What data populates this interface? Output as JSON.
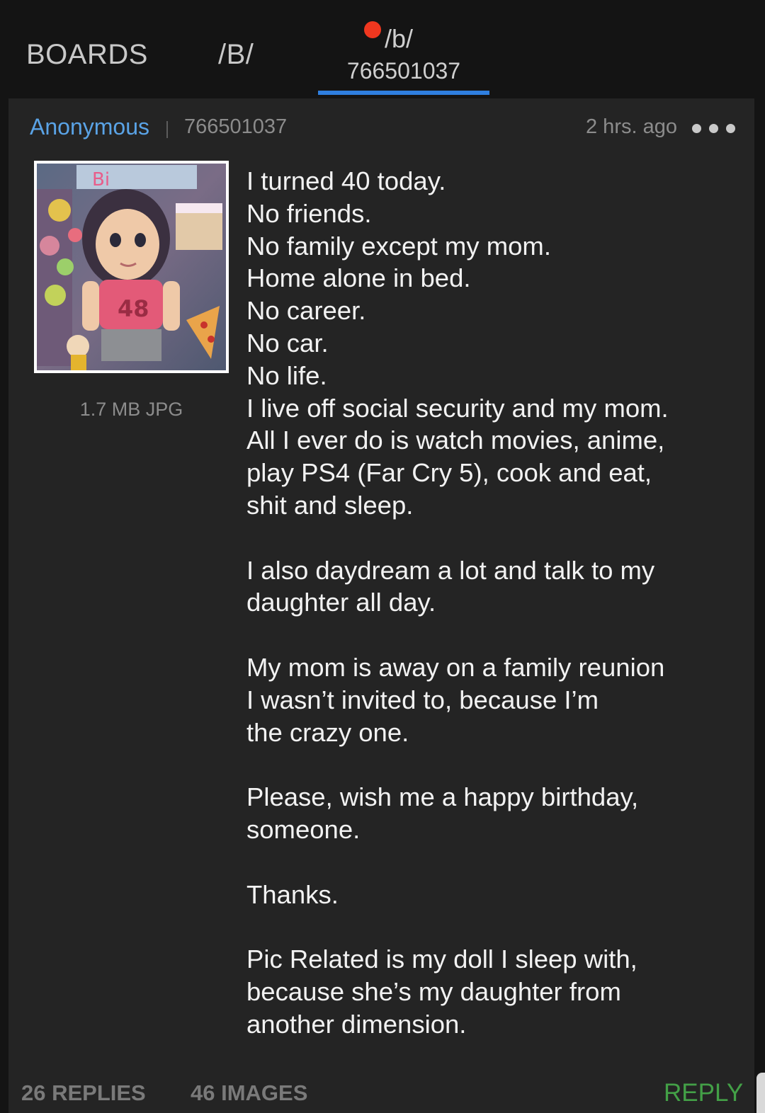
{
  "nav": {
    "boards_label": "BOARDS",
    "board_label": "/B/",
    "thread_board": "/b/",
    "thread_id": "766501037",
    "active_indicator_color": "#2f7fe0",
    "notification_dot_color": "#f0371f"
  },
  "post": {
    "author": "Anonymous",
    "id": "766501037",
    "time": "2 hrs. ago",
    "file_info": "1.7 MB JPG",
    "body_lines": [
      "I turned 40 today.",
      "No friends.",
      "No family except my mom.",
      "Home alone in bed.",
      "No career.",
      "No car.",
      "No life.",
      "I live off social security and my mom.",
      "All I ever do is watch movies, anime,",
      "play PS4 (Far Cry 5), cook and eat,",
      "shit and sleep.",
      "",
      "I also daydream a lot and talk to my",
      "daughter all day.",
      "",
      "My mom is away on a family reunion",
      "I wasn’t invited to, because I’m",
      "the crazy one.",
      "",
      "Please, wish me a happy birthday,",
      "someone.",
      "",
      "Thanks.",
      "",
      "Pic Related is my doll I sleep with,",
      "because she’s my daughter from",
      "another dimension."
    ],
    "thumbnail_jersey_number": "48"
  },
  "footer": {
    "replies": "26 REPLIES",
    "images": "46 IMAGES",
    "reply_label": "REPLY",
    "reply_color": "#43a047"
  },
  "icons": {
    "more": "more-dots-icon"
  }
}
